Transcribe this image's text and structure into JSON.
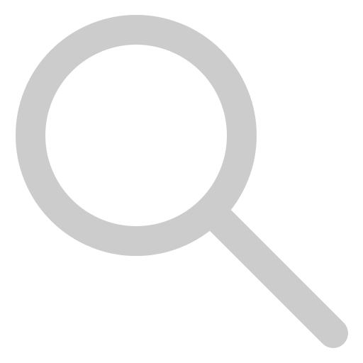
{
  "icon": {
    "name": "search-icon",
    "color": "#cccccc",
    "background": "#ffffff"
  }
}
